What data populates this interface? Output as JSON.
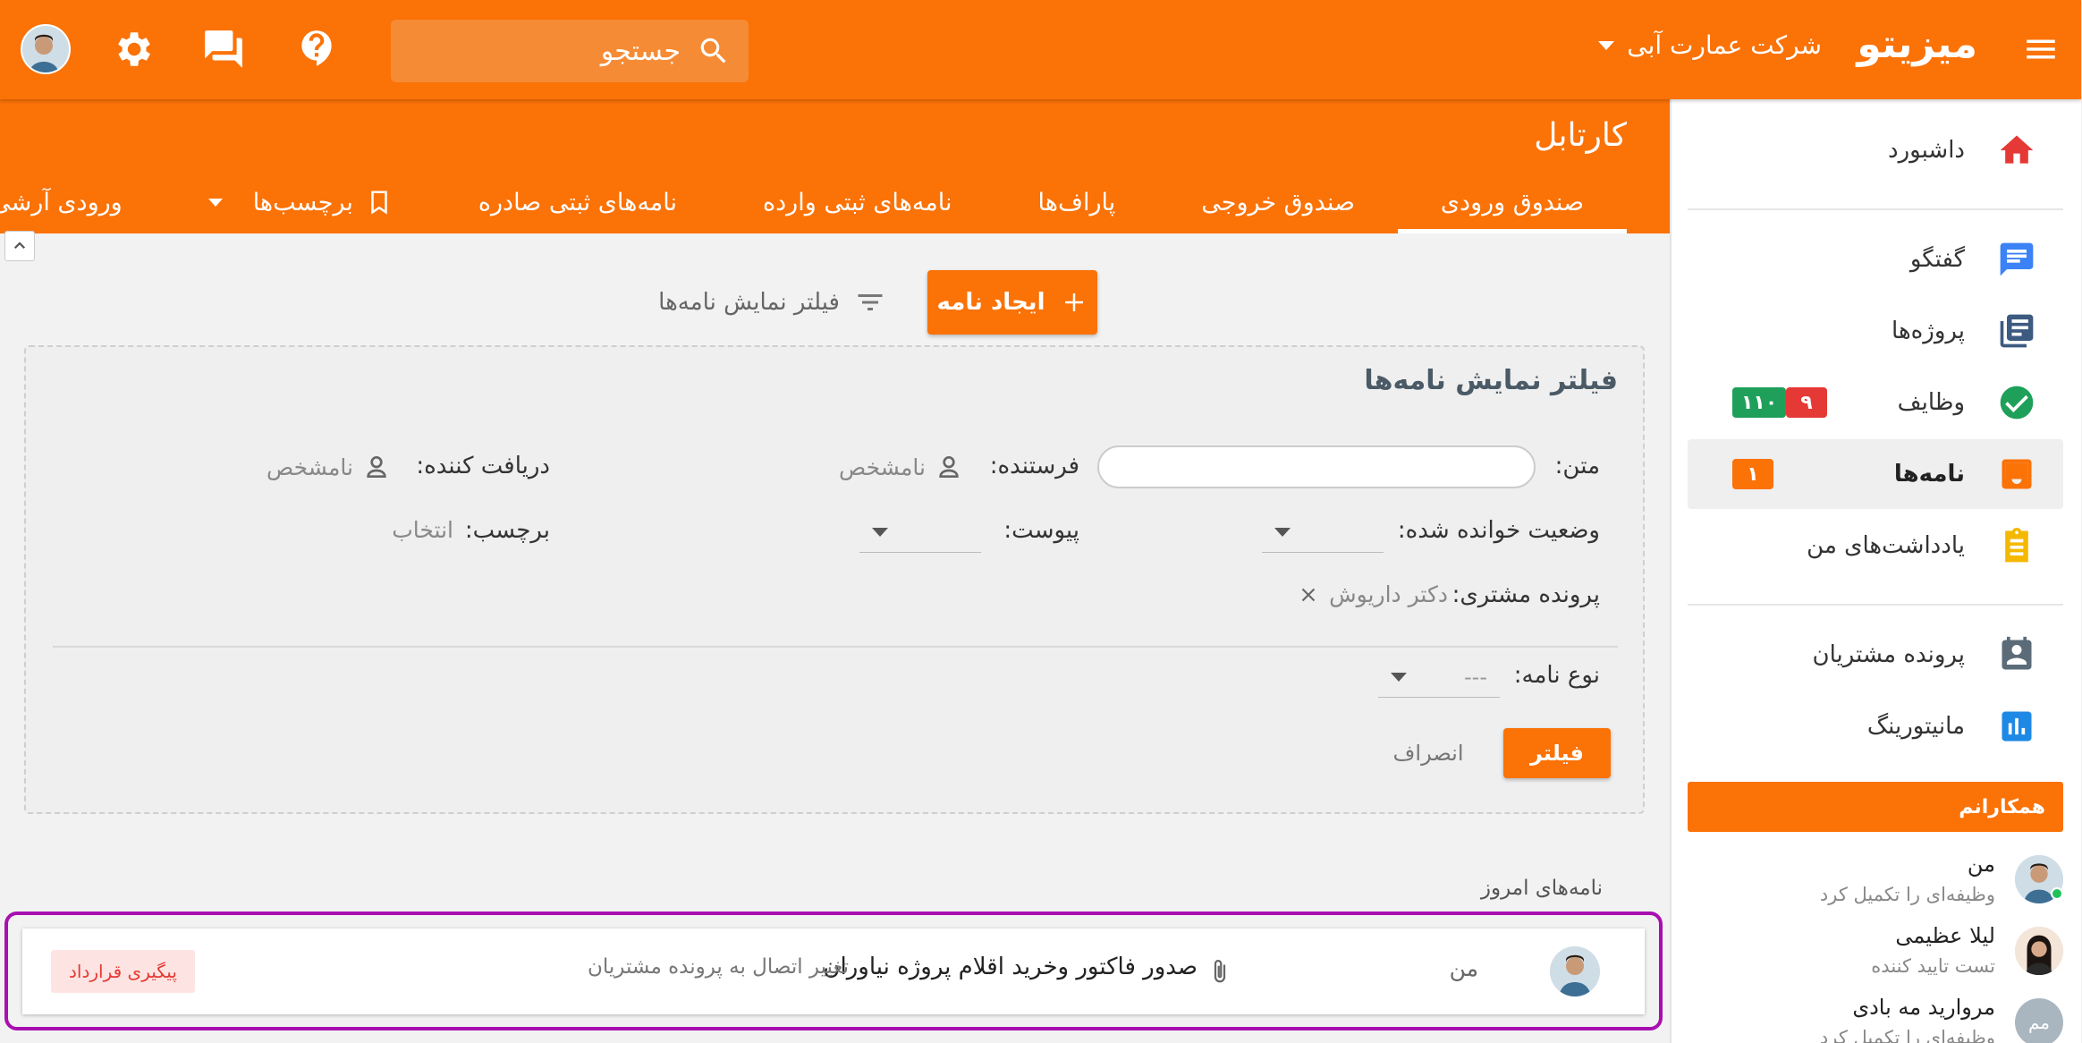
{
  "header": {
    "brand": "میزیتو",
    "company": "شرکت عمارت آبی",
    "search_placeholder": "جستجو"
  },
  "sidebar": {
    "items": [
      {
        "label": "داشبورد",
        "icon": "home-icon"
      },
      {
        "label": "گفتگو",
        "icon": "chat-icon"
      },
      {
        "label": "پروژه‌ها",
        "icon": "projects-icon"
      },
      {
        "label": "وظایف",
        "icon": "check-circle-icon",
        "badges": [
          "۱۱۰",
          "۹"
        ]
      },
      {
        "label": "نامه‌ها",
        "icon": "inbox-icon",
        "badges": [
          "۱"
        ],
        "active": true
      },
      {
        "label": "یادداشت‌های من",
        "icon": "clipboard-icon"
      },
      {
        "label": "پرونده مشتریان",
        "icon": "contacts-icon"
      },
      {
        "label": "مانیتورینگ",
        "icon": "chart-icon"
      }
    ],
    "colleagues_title": "همکارانم",
    "colleagues": [
      {
        "name": "من",
        "status": "وظیفه‌ای را تکمیل کرد"
      },
      {
        "name": "لیلا عظیمی",
        "status": "تست تایید کننده"
      },
      {
        "name": "مروارید مه بادی",
        "status": "وظیفه‌ای را تکمیل کرد",
        "initials": "مم"
      }
    ]
  },
  "page": {
    "title": "کارتابل",
    "tabs": [
      "صندوق ورودی",
      "صندوق خروجی",
      "پاراف‌ها",
      "نامه‌های ثبتی وارده",
      "نامه‌های ثبتی صادره",
      "برچسب‌ها",
      "ورودی آرشی"
    ],
    "create_label": "ایجاد نامه",
    "filter_toggle_label": "فیلتر نمایش نامه‌ها"
  },
  "filter": {
    "title": "فیلتر نمایش نامه‌ها",
    "text_label": "متن:",
    "sender_label": "فرستنده:",
    "sender_value": "نامشخص",
    "receiver_label": "دریافت کننده:",
    "receiver_value": "نامشخص",
    "read_status_label": "وضعیت خوانده شده:",
    "attachment_label": "پیوست:",
    "tag_label": "برچسب:",
    "tag_value": "انتخاب",
    "client_label": "پرونده مشتری:",
    "client_value": "دکتر داریوش",
    "type_label": "نوع نامه:",
    "type_value": "---",
    "filter_button": "فیلتر",
    "cancel_button": "انصراف"
  },
  "letters": {
    "section_title": "نامه‌های امروز",
    "rows": [
      {
        "sender": "من",
        "subject": "صدور فاکتور وخرید اقلام پروژه نیاوران",
        "description": "تغییر اتصال به پرونده مشتریان",
        "tag": "پیگیری قرارداد"
      }
    ]
  },
  "colors": {
    "accent": "#fb7207",
    "highlight": "#a80fb0"
  }
}
